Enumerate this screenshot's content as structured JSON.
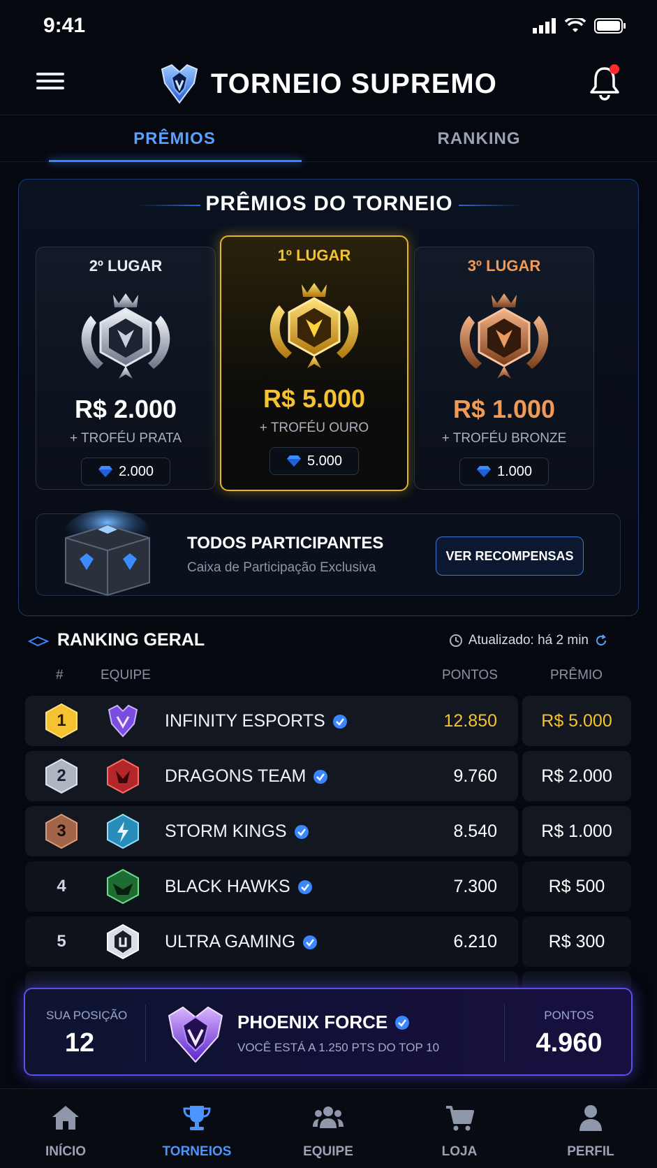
{
  "status": {
    "time": "9:41"
  },
  "header": {
    "title": "TORNEIO SUPREMO"
  },
  "tabs": [
    {
      "label": "PRÊMIOS",
      "active": true
    },
    {
      "label": "RANKING",
      "active": false
    }
  ],
  "prizes": {
    "title": "PRÊMIOS DO TORNEIO",
    "cards": [
      {
        "place": "2º LUGAR",
        "amount": "R$ 2.000",
        "trophy": "+ TROFÉU PRATA",
        "gems": "2.000",
        "color": "#ffffff",
        "label_color": "#e8ecf4"
      },
      {
        "place": "1º LUGAR",
        "amount": "R$ 5.000",
        "trophy": "+ TROFÉU OURO",
        "gems": "5.000",
        "color": "#f5c232",
        "label_color": "#f5c232"
      },
      {
        "place": "3º LUGAR",
        "amount": "R$ 1.000",
        "trophy": "+ TROFÉU BRONZE",
        "gems": "1.000",
        "color": "#f09a56",
        "label_color": "#f09a56"
      }
    ],
    "participants": {
      "title": "TODOS PARTICIPANTES",
      "subtitle": "Caixa de Participação Exclusiva",
      "button": "VER RECOMPENSAS"
    }
  },
  "ranking": {
    "title": "RANKING GERAL",
    "updated": "Atualizado: há 2 min",
    "columns": {
      "rank": "#",
      "team": "EQUIPE",
      "points": "PONTOS",
      "prize": "PRÊMIO"
    },
    "rows": [
      {
        "rank": "1",
        "team": "INFINITY ESPORTS",
        "points": "12.850",
        "prize": "R$ 5.000",
        "highlight": "#f5c232"
      },
      {
        "rank": "2",
        "team": "DRAGONS TEAM",
        "points": "9.760",
        "prize": "R$ 2.000"
      },
      {
        "rank": "3",
        "team": "STORM KINGS",
        "points": "8.540",
        "prize": "R$ 1.000"
      },
      {
        "rank": "4",
        "team": "BLACK HAWKS",
        "points": "7.300",
        "prize": "R$ 500"
      },
      {
        "rank": "5",
        "team": "ULTRA GAMING",
        "points": "6.210",
        "prize": "R$ 300"
      }
    ]
  },
  "my_position": {
    "label": "SUA POSIÇÃO",
    "position": "12",
    "team": "PHOENIX FORCE",
    "note": "VOCÊ ESTÁ A 1.250 PTS DO TOP 10",
    "points_label": "PONTOS",
    "points": "4.960"
  },
  "nav": [
    {
      "label": "INÍCIO",
      "icon": "home-icon",
      "active": false
    },
    {
      "label": "TORNEIOS",
      "icon": "trophy-icon",
      "active": true
    },
    {
      "label": "EQUIPE",
      "icon": "team-icon",
      "active": false
    },
    {
      "label": "LOJA",
      "icon": "cart-icon",
      "active": false
    },
    {
      "label": "PERFIL",
      "icon": "profile-icon",
      "active": false
    }
  ],
  "colors": {
    "accent": "#3a86ff",
    "gold": "#f5c232",
    "silver": "#c8ced8",
    "bronze": "#c97a4a",
    "purple": "#6a4cff"
  }
}
